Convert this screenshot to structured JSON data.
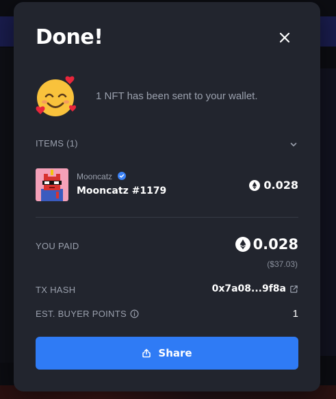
{
  "modal": {
    "title": "Done!",
    "message": "1 NFT has been sent to your wallet."
  },
  "items": {
    "label": "ITEMS (1)",
    "list": [
      {
        "collection": "Mooncatz",
        "verified": true,
        "name": "Mooncatz #1179",
        "price": "0.028"
      }
    ]
  },
  "summary": {
    "paid_label": "YOU PAID",
    "paid_value": "0.028",
    "paid_usd": "($37.03)",
    "tx_label": "TX HASH",
    "tx_value": "0x7a08...9f8a",
    "points_label": "EST. BUYER POINTS",
    "points_value": "1"
  },
  "share_button": {
    "label": "Share"
  },
  "icons": {
    "close": "close-icon",
    "emoji": "smiling-face-with-hearts-icon",
    "chevron": "chevron-down-icon",
    "verified": "verified-badge-icon",
    "eth": "eth-icon",
    "external": "external-link-icon",
    "info": "info-icon",
    "share": "share-icon"
  },
  "colors": {
    "modal_bg": "#22252e",
    "accent": "#2f7bf5",
    "muted_text": "#9ba1ae",
    "verified": "#3b82f6"
  }
}
